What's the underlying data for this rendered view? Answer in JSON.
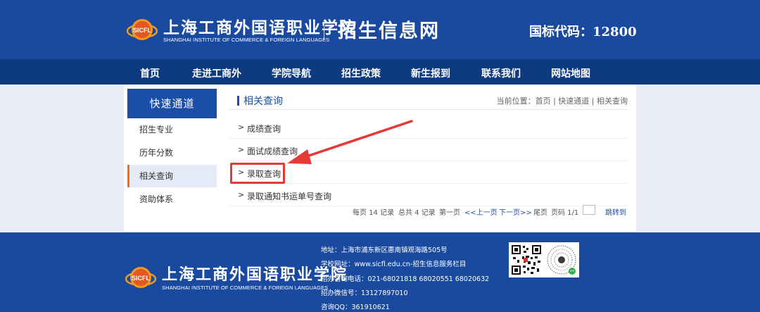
{
  "header": {
    "school_name_cn": "上海工商外国语职业学院",
    "school_name_en": "SHANGHAI INSTITUTE OF COMMERCE & FOREIGN LANGUAGES",
    "emblem_text": "SICFL",
    "site_title": "招生信息网",
    "code_label": "国标代码：12800"
  },
  "nav": {
    "items": [
      {
        "label": "首页"
      },
      {
        "label": "走进工商外"
      },
      {
        "label": "学院导航"
      },
      {
        "label": "招生政策"
      },
      {
        "label": "新生报到"
      },
      {
        "label": "联系我们"
      },
      {
        "label": "网站地图"
      }
    ]
  },
  "sidebar": {
    "title": "快速通道",
    "items": [
      {
        "label": "招生专业"
      },
      {
        "label": "历年分数"
      },
      {
        "label": "相关查询"
      },
      {
        "label": "资助体系"
      }
    ],
    "active_index": 2
  },
  "main": {
    "title": "相关查询",
    "breadcrumb": "当前位置：首页 | 快速通道 | 相关查询",
    "arrow_glyph": ">",
    "items": [
      {
        "label": "成绩查询"
      },
      {
        "label": "面试成绩查询"
      },
      {
        "label": "录取查询"
      },
      {
        "label": "录取通知书运单号查询"
      }
    ],
    "highlighted_index": 2
  },
  "pager": {
    "per_page": "每页 14 记录",
    "total": "总共 4 记录",
    "first": "第一页",
    "prev": "<<上一页",
    "next": "下一页>>",
    "last": "尾页",
    "page_info": "页码 1/1",
    "jump": "跳转到"
  },
  "footer": {
    "lines": [
      "地址：上海市浦东新区惠南镇观海路505号",
      "学校网址：www.sicfl.edu.cn-招生信息服务栏目",
      "招办咨询电话：021-68021818 68020551 68020632",
      "招办微信号：13127897010",
      "咨询QQ：361910621"
    ]
  },
  "colors": {
    "header_blue": "#1a4aa0",
    "nav_blue": "#0e3a80",
    "accent_orange": "#e8712a",
    "annotation_red": "#e53935"
  }
}
